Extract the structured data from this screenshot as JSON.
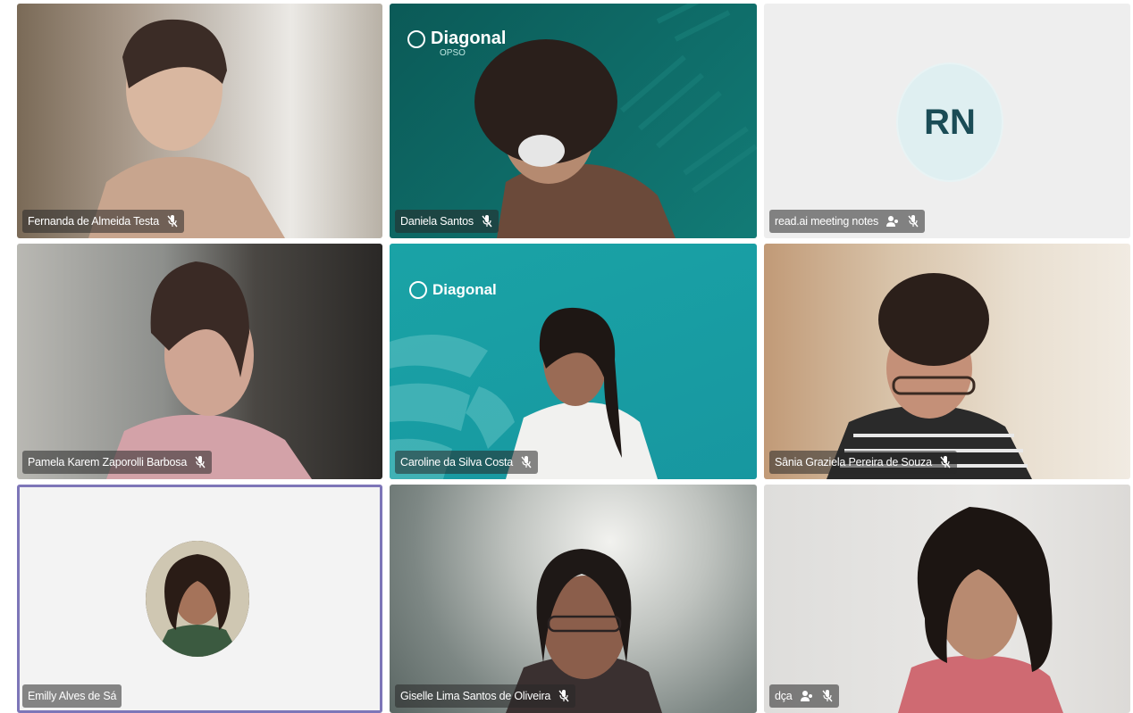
{
  "tiles": [
    {
      "name": "Fernanda de Almeida Testa",
      "bg": "room1"
    },
    {
      "name": "Daniela Santos",
      "bg": "teal-dark",
      "logo": "Diagonal",
      "logo_sub": "OPSO"
    },
    {
      "name": "read.ai meeting notes",
      "bg": "light",
      "initials": "RN"
    },
    {
      "name": "Pamela Karem Zaporolli Barbosa",
      "bg": "room2"
    },
    {
      "name": "Caroline da Silva Costa",
      "bg": "teal",
      "logo": "Diagonal"
    },
    {
      "name": "Sânia Grazielа Pereira de Souza",
      "bg": "room3"
    },
    {
      "name": "Emilly Alves de Sá",
      "bg": "white"
    },
    {
      "name": "Giselle Lima Santos de Oliveira",
      "bg": "room4"
    },
    {
      "name": "dça",
      "bg": "wall"
    }
  ],
  "colors": {
    "teal_dark": "#0f6e6a",
    "teal": "#1aa3a6",
    "active_border": "#7d76b8",
    "label_bg": "rgba(40,40,40,0.55)"
  },
  "icons": {
    "muted": "mic-off-icon",
    "notes": "notes-bot-icon"
  }
}
